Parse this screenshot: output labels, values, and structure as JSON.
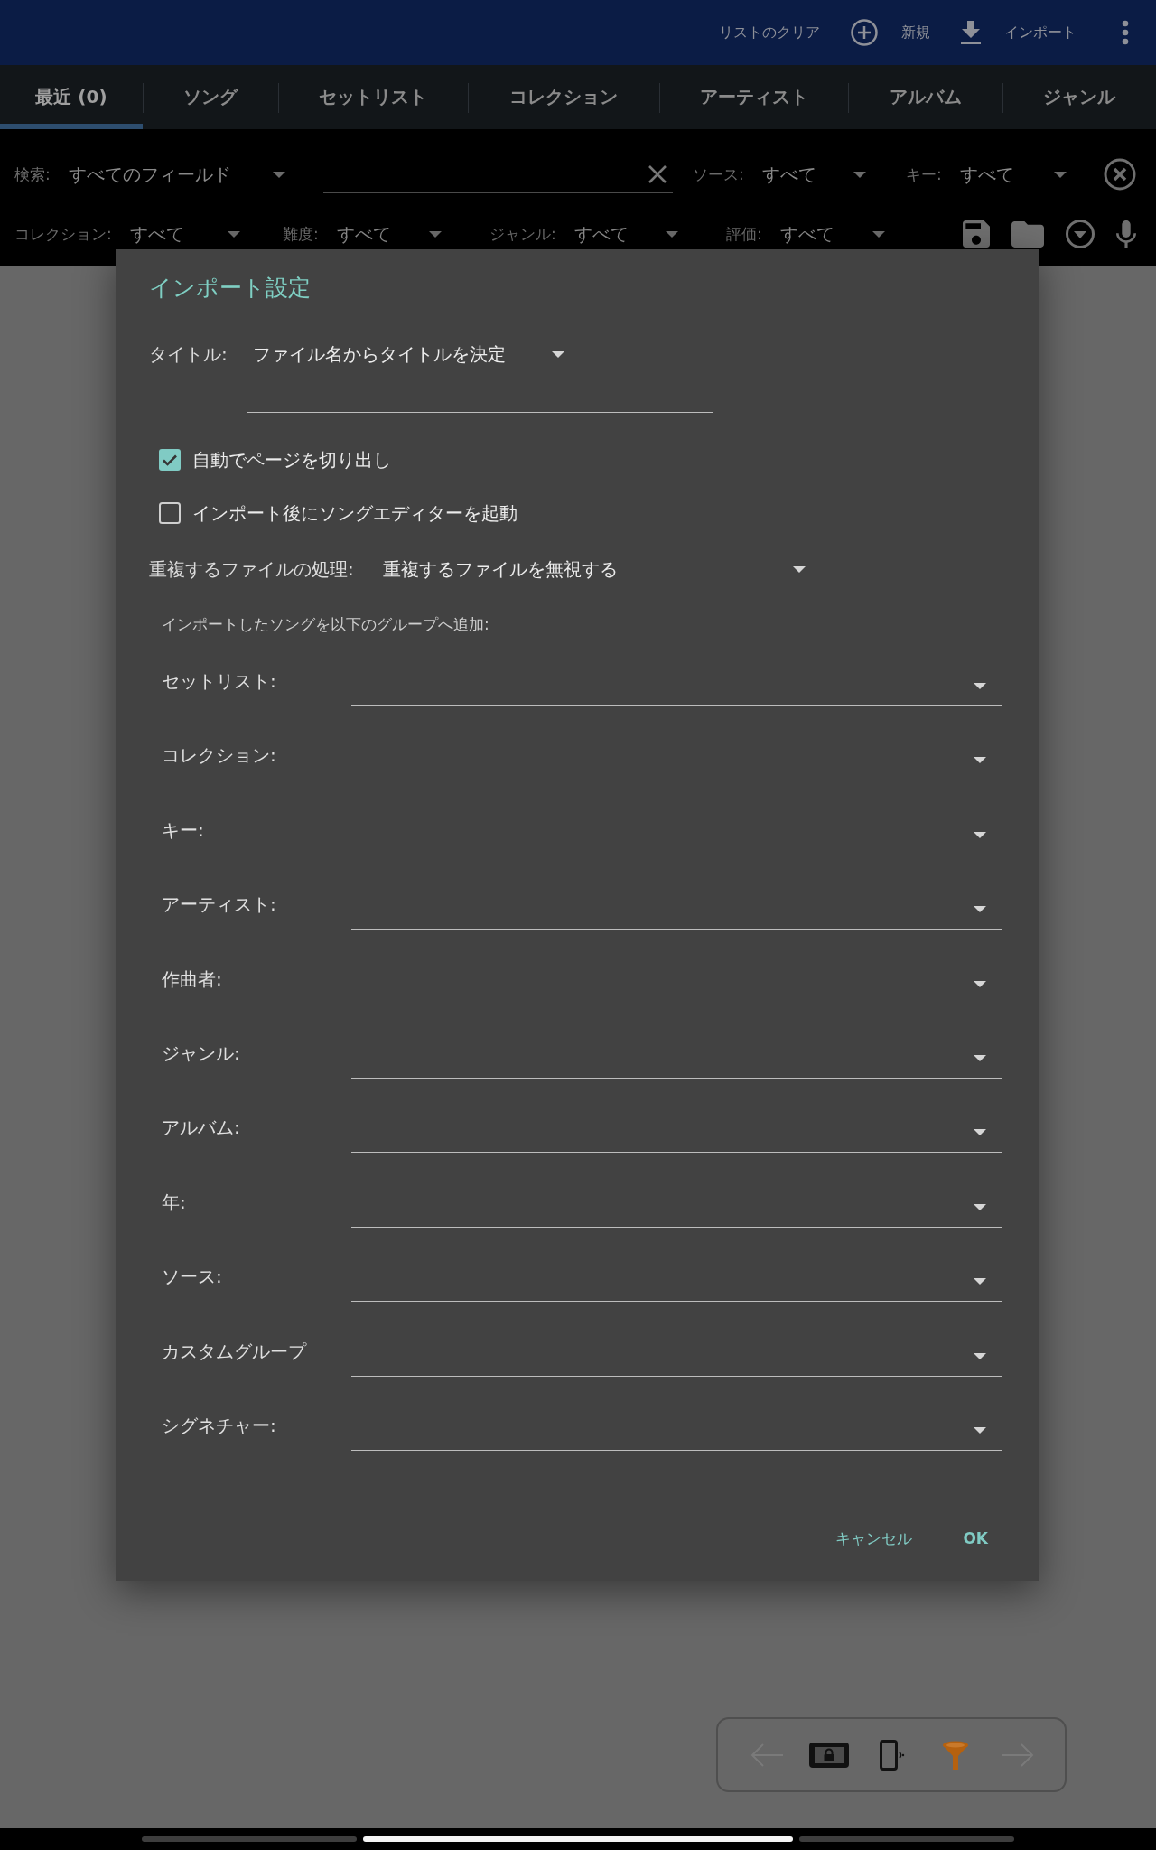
{
  "app_bar": {
    "actions": [
      {
        "label": "リストのクリア",
        "kind": "clear"
      },
      {
        "label": "新規",
        "kind": "add"
      },
      {
        "label": "インポート",
        "kind": "import"
      }
    ]
  },
  "tabs": [
    {
      "label": "最近 (0)",
      "selected": true
    },
    {
      "label": "ソング",
      "selected": false
    },
    {
      "label": "セットリスト",
      "selected": false
    },
    {
      "label": "コレクション",
      "selected": false
    },
    {
      "label": "アーティスト",
      "selected": false
    },
    {
      "label": "アルバム",
      "selected": false
    },
    {
      "label": "ジャンル",
      "selected": false
    }
  ],
  "search": {
    "label": "検索:",
    "value": "すべてのフィールド"
  },
  "filters_row_1": [
    {
      "label": "ソース:",
      "value": "すべて"
    },
    {
      "label": "キー:",
      "value": "すべて"
    }
  ],
  "filters_row_2": [
    {
      "label": "コレクション:",
      "value": "すべて"
    },
    {
      "label": "難度:",
      "value": "すべて"
    },
    {
      "label": "ジャンル:",
      "value": "すべて"
    },
    {
      "label": "評価:",
      "value": "すべて"
    }
  ],
  "dialog": {
    "title": "インポート設定",
    "title_select": {
      "label": "タイトル:",
      "value": "ファイル名からタイトルを決定"
    },
    "checkboxes": [
      {
        "label": "自動でページを切り出し",
        "checked": true
      },
      {
        "label": "インポート後にソングエディターを起動",
        "checked": false
      }
    ],
    "duplicate_select": {
      "label": "重複するファイルの処理:",
      "value": "重複するファイルを無視する"
    },
    "groups_heading": "インポートしたソングを以下のグループへ追加:",
    "groups": [
      "セットリスト:",
      "コレクション:",
      "キー:",
      "アーティスト:",
      "作曲者:",
      "ジャンル:",
      "アルバム:",
      "年:",
      "ソース:",
      "カスタムグループ",
      "シグネチャー:"
    ],
    "buttons": [
      {
        "label": "キャンセル",
        "kind": "cancel"
      },
      {
        "label": "OK",
        "kind": "confirm"
      }
    ]
  },
  "page_toolbar": {
    "back": {
      "disabled": true
    },
    "forward": {
      "disabled": true
    }
  }
}
